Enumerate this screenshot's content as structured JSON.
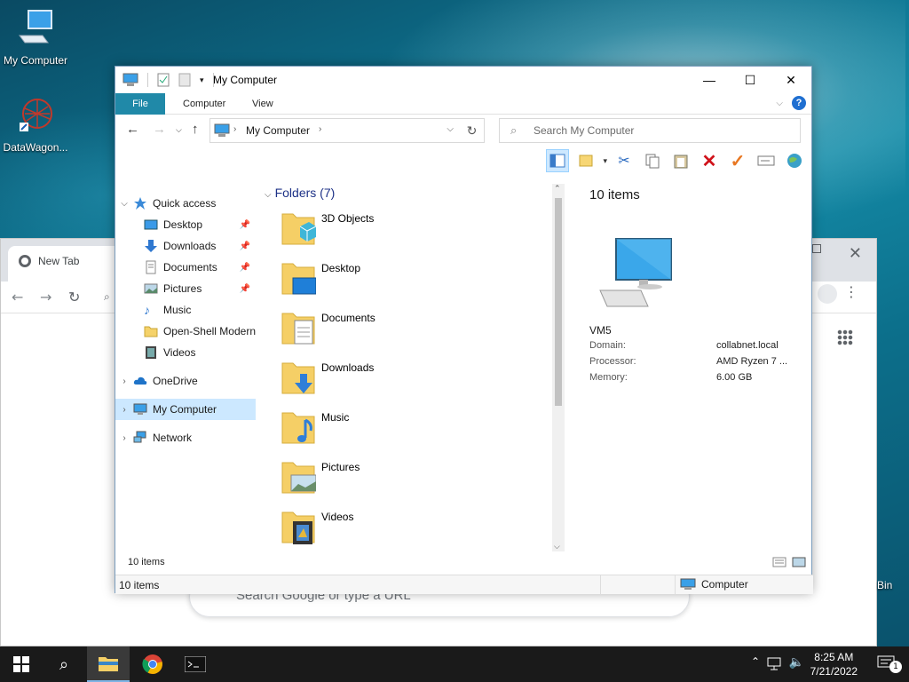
{
  "desktop": {
    "icons": [
      {
        "label": "My Computer"
      },
      {
        "label": "DataWagon..."
      }
    ],
    "recycle_bin_label": "Bin"
  },
  "chrome": {
    "tab_title": "New Tab",
    "search_placeholder": "Search Google or type a URL"
  },
  "explorer": {
    "title": "My Computer",
    "ribbon_tabs": [
      "File",
      "Computer",
      "View"
    ],
    "address": "My Computer",
    "search_placeholder": "Search My Computer",
    "nav": {
      "quick_access": "Quick access",
      "quick_items": [
        "Desktop",
        "Downloads",
        "Documents",
        "Pictures",
        "Music",
        "Open-Shell Modern",
        "Videos"
      ],
      "onedrive": "OneDrive",
      "my_computer": "My Computer",
      "network": "Network"
    },
    "section_title": "Folders (7)",
    "folders": [
      "3D Objects",
      "Desktop",
      "Documents",
      "Downloads",
      "Music",
      "Pictures",
      "Videos"
    ],
    "details": {
      "count": "10 items",
      "name": "VM5",
      "rows": [
        {
          "key": "Domain:",
          "value": "collabnet.local"
        },
        {
          "key": "Processor:",
          "value": "AMD Ryzen 7 ..."
        },
        {
          "key": "Memory:",
          "value": "6.00 GB"
        }
      ]
    },
    "status_inner": "10 items",
    "status_outer": "10 items",
    "status_location": "Computer"
  },
  "taskbar": {
    "time": "8:25 AM",
    "date": "7/21/2022",
    "notification_count": "1"
  }
}
